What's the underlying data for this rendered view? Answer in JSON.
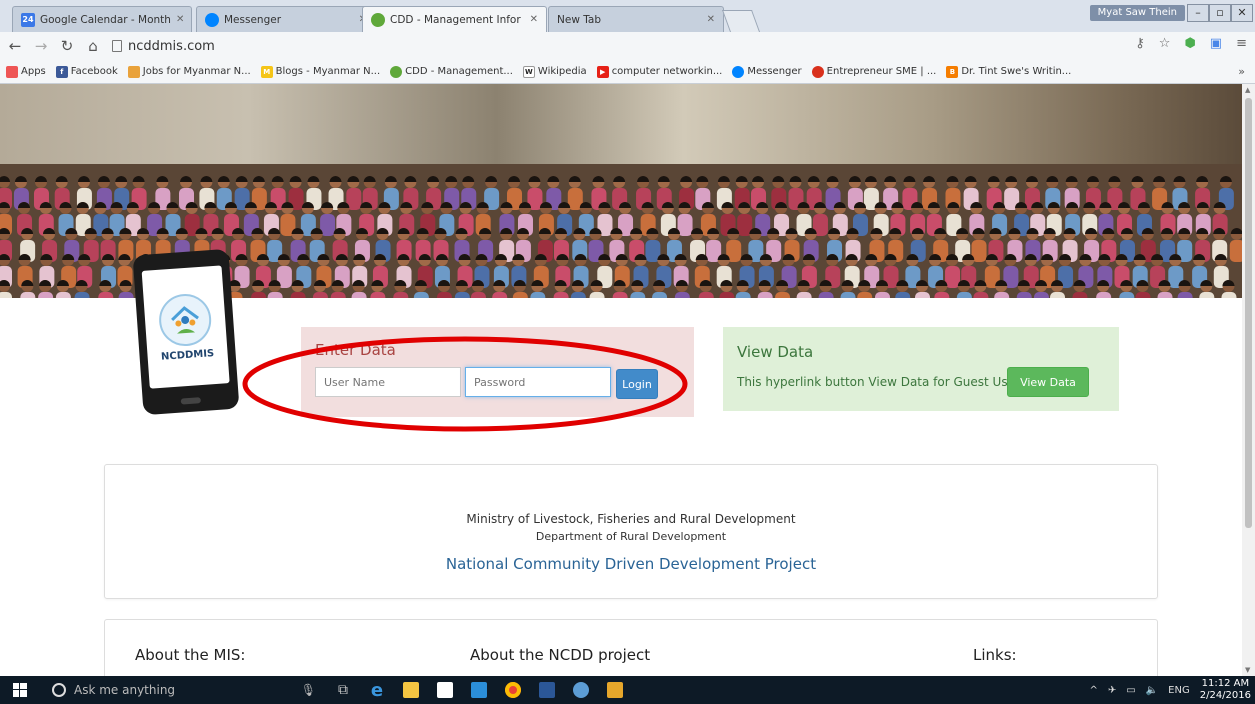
{
  "browser": {
    "tabs": [
      {
        "icon_text": "24",
        "title": "Google Calendar - Month",
        "color": "#3b78e7"
      },
      {
        "icon_text": "m",
        "title": "Messenger",
        "color": "#0084ff"
      },
      {
        "icon_text": "",
        "title": "CDD - Management Infor",
        "color": "#5fa83a",
        "active": true
      },
      {
        "icon_text": "",
        "title": "New Tab",
        "color": "#c9d2dd"
      }
    ],
    "user": "Myat Saw Thein",
    "url": "ncddmis.com",
    "bookmarks": [
      {
        "label": "Apps",
        "icon": "apps-icon",
        "color": "#e55"
      },
      {
        "label": "Facebook",
        "icon": "facebook-icon",
        "color": "#3b5998"
      },
      {
        "label": "Jobs for Myanmar N...",
        "icon": "jobs-icon",
        "color": "#e9a23b"
      },
      {
        "label": "Blogs - Myanmar N...",
        "icon": "blogs-icon",
        "color": "#f5c518"
      },
      {
        "label": "CDD - Management...",
        "icon": "cdd-icon",
        "color": "#5fa83a"
      },
      {
        "label": "Wikipedia",
        "icon": "wikipedia-icon",
        "color": "#555"
      },
      {
        "label": "computer networkin...",
        "icon": "youtube-icon",
        "color": "#e62117"
      },
      {
        "label": "Messenger",
        "icon": "messenger-icon",
        "color": "#0084ff"
      },
      {
        "label": "Entrepreneur SME | ...",
        "icon": "entrepreneur-icon",
        "color": "#d9301c"
      },
      {
        "label": "Dr. Tint Swe's Writin...",
        "icon": "blogger-icon",
        "color": "#f57d00"
      }
    ],
    "more": "»"
  },
  "page": {
    "phone_caption": "NCDDMIS",
    "enter_data": {
      "title": "Enter Data",
      "username_placeholder": "User Name",
      "password_placeholder": "Password",
      "login_label": "Login"
    },
    "view_data": {
      "title": "View Data",
      "description": "This hyperlink button View Data for Guest User",
      "button_label": "View Data"
    },
    "footer": {
      "ministry": "Ministry of Livestock, Fisheries and Rural Development",
      "department": "Department of Rural Development",
      "project": "National Community Driven Development Project"
    },
    "about": {
      "mis": "About the MIS:",
      "ncdd": "About the NCDD project",
      "links": "Links:"
    }
  },
  "taskbar": {
    "search_placeholder": "Ask me anything",
    "language": "ENG",
    "time": "11:12 AM",
    "date": "2/24/2016"
  },
  "colors": {
    "annotation": "#e00000",
    "danger_panel": "#f2dede",
    "success_panel": "#dff0d8",
    "primary": "#428bca",
    "success": "#5cb85c"
  }
}
